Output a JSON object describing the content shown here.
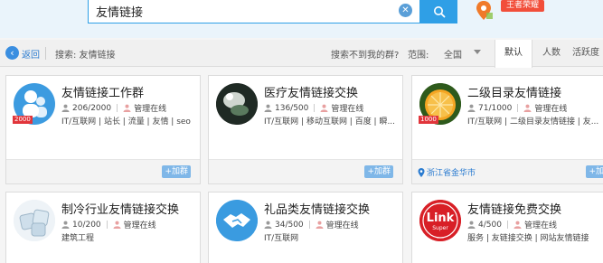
{
  "search": {
    "value": "友情链接",
    "clear_glyph": "✕",
    "honor_badge": "王者荣耀"
  },
  "filter": {
    "back": "返回",
    "search_label": "搜索: 友情链接",
    "not_found": "搜索不到我的群?",
    "range_label": "范围:",
    "range_value": "全国",
    "tabs": [
      "默认",
      "人数",
      "活跃度"
    ]
  },
  "cards": [
    {
      "name": "友情链接工作群",
      "level": "2000",
      "members": "206/2000",
      "admin": "管理在线",
      "tags": "IT/互联网 | 站长 | 流量 | 友情 | seo",
      "join": "+加群",
      "location": "",
      "avatar": "qq-people-icon"
    },
    {
      "name": "医疗友情链接交换",
      "level": "",
      "members": "136/500",
      "admin": "管理在线",
      "tags": "IT/互联网 | 移动互联网 | 百度 | 瞬...",
      "join": "+加群",
      "location": "",
      "avatar": "photo-avatar-icon"
    },
    {
      "name": "二级目录友情链接",
      "level": "1000",
      "members": "71/1000",
      "admin": "管理在线",
      "tags": "IT/互联网 | 二级目录友情链接 | 友...",
      "join": "+加群",
      "location": "浙江省金华市",
      "avatar": "orange-fruit-icon"
    },
    {
      "name": "制冷行业友情链接交换",
      "level": "",
      "members": "10/200",
      "admin": "管理在线",
      "tags": "建筑工程",
      "join": "",
      "location": "",
      "avatar": "ice-cubes-icon"
    },
    {
      "name": "礼品类友情链接交换",
      "level": "",
      "members": "34/500",
      "admin": "管理在线",
      "tags": "IT/互联网",
      "join": "",
      "location": "",
      "avatar": "handshake-icon"
    },
    {
      "name": "友情链接免费交换",
      "level": "",
      "members": "4/500",
      "admin": "管理在线",
      "tags": "服务 | 友链接交换 | 网站友情链接",
      "join": "",
      "location": "",
      "avatar": "link-super-logo",
      "logo_text": "Link",
      "logo_sub": "Super"
    }
  ],
  "colors": {
    "accent": "#2f9fe6",
    "join": "#7fb7e8",
    "level": "#e1353b",
    "badge": "#f24e3a"
  }
}
